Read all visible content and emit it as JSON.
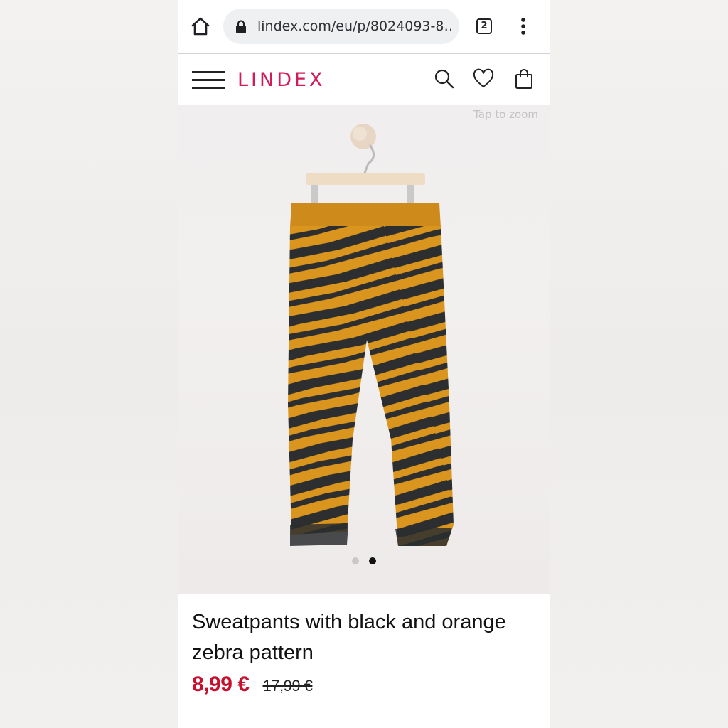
{
  "browser": {
    "url": "lindex.com/eu/p/8024093-8…",
    "tab_count": "2",
    "icons": [
      "home-icon",
      "lock-icon",
      "tab-switcher-icon",
      "more-vert-icon"
    ]
  },
  "site": {
    "logo": "LINDEX",
    "icons": [
      "menu-icon",
      "search-icon",
      "heart-icon",
      "bag-icon"
    ]
  },
  "gallery": {
    "zoom_hint": "Tap to zoom",
    "image_count": 2,
    "active_index": 1
  },
  "product": {
    "title": "Sweatpants with black and orange zebra pattern",
    "price_current": "8,99 €",
    "price_original": "17,99 €"
  },
  "colors": {
    "brand": "#d11b5a",
    "price_sale": "#c8102e",
    "pants_orange": "#d9951e",
    "pants_dark": "#2c2e2f"
  }
}
